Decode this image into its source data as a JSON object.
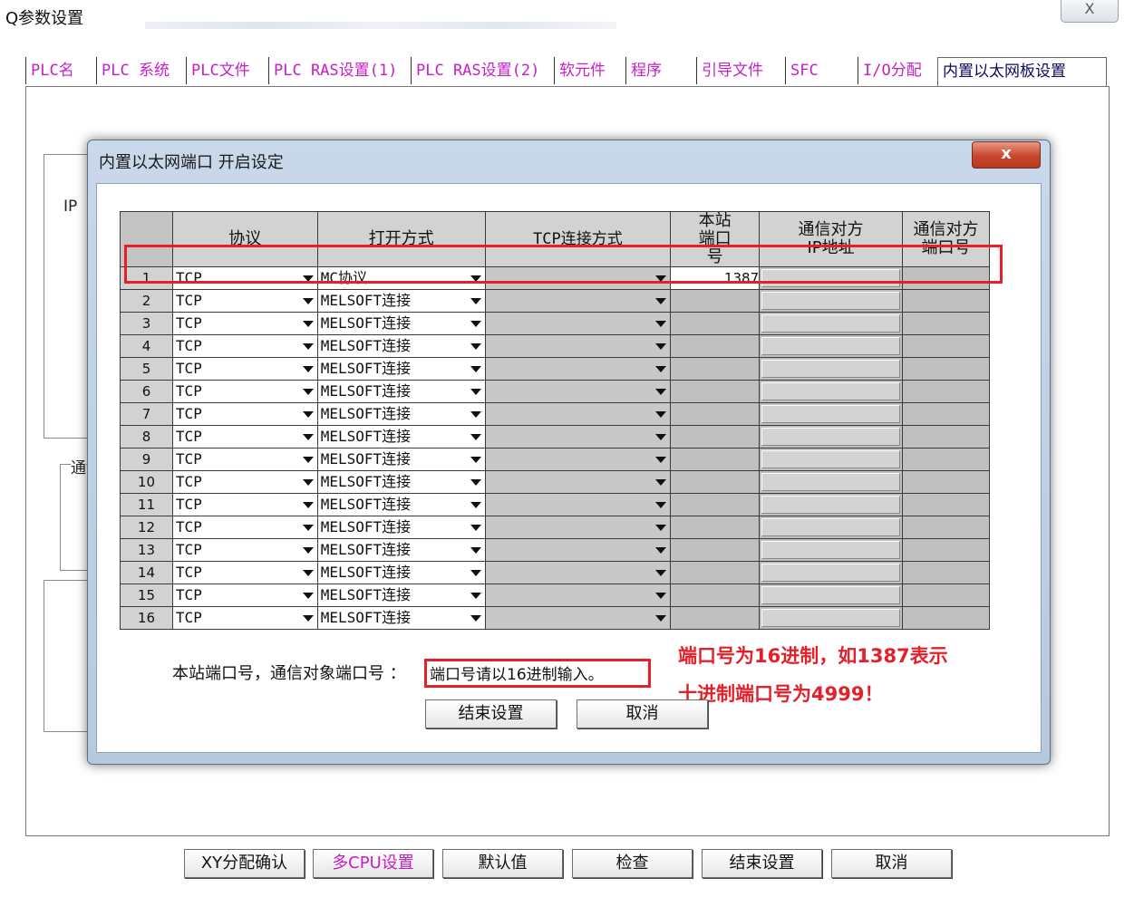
{
  "window": {
    "title": "Q参数设置",
    "close_glyph": "X"
  },
  "tabs": [
    {
      "label": "PLC名"
    },
    {
      "label": "PLC 系统"
    },
    {
      "label": "PLC文件"
    },
    {
      "label": "PLC RAS设置(1)"
    },
    {
      "label": "PLC RAS设置(2)"
    },
    {
      "label": "软元件"
    },
    {
      "label": "程序"
    },
    {
      "label": "引导文件"
    },
    {
      "label": "SFC"
    },
    {
      "label": "I/O分配"
    },
    {
      "label": "内置以太网板设置",
      "active": true
    }
  ],
  "background_fragments": {
    "group1": "IP",
    "group2": "通"
  },
  "dialog": {
    "title": "内置以太网端口 开启设定",
    "close_glyph": "x",
    "columns": {
      "protocol": "协议",
      "open_method": "打开方式",
      "tcp_mode": "TCP连接方式",
      "local_port": "本站端口号",
      "peer_ip": "通信对方IP地址",
      "peer_port": "通信对方端口号"
    },
    "rows": [
      {
        "no": "1",
        "protocol": "TCP",
        "open_method": "MC协议",
        "local_port": "1387"
      },
      {
        "no": "2",
        "protocol": "TCP",
        "open_method": "MELSOFT连接",
        "local_port": ""
      },
      {
        "no": "3",
        "protocol": "TCP",
        "open_method": "MELSOFT连接",
        "local_port": ""
      },
      {
        "no": "4",
        "protocol": "TCP",
        "open_method": "MELSOFT连接",
        "local_port": ""
      },
      {
        "no": "5",
        "protocol": "TCP",
        "open_method": "MELSOFT连接",
        "local_port": ""
      },
      {
        "no": "6",
        "protocol": "TCP",
        "open_method": "MELSOFT连接",
        "local_port": ""
      },
      {
        "no": "7",
        "protocol": "TCP",
        "open_method": "MELSOFT连接",
        "local_port": ""
      },
      {
        "no": "8",
        "protocol": "TCP",
        "open_method": "MELSOFT连接",
        "local_port": ""
      },
      {
        "no": "9",
        "protocol": "TCP",
        "open_method": "MELSOFT连接",
        "local_port": ""
      },
      {
        "no": "10",
        "protocol": "TCP",
        "open_method": "MELSOFT连接",
        "local_port": ""
      },
      {
        "no": "11",
        "protocol": "TCP",
        "open_method": "MELSOFT连接",
        "local_port": ""
      },
      {
        "no": "12",
        "protocol": "TCP",
        "open_method": "MELSOFT连接",
        "local_port": ""
      },
      {
        "no": "13",
        "protocol": "TCP",
        "open_method": "MELSOFT连接",
        "local_port": ""
      },
      {
        "no": "14",
        "protocol": "TCP",
        "open_method": "MELSOFT连接",
        "local_port": ""
      },
      {
        "no": "15",
        "protocol": "TCP",
        "open_method": "MELSOFT连接",
        "local_port": ""
      },
      {
        "no": "16",
        "protocol": "TCP",
        "open_method": "MELSOFT连接",
        "local_port": ""
      }
    ],
    "note_label": "本站端口号，通信对象端口号 ：",
    "note_value": "端口号请以16进制输入。",
    "annotation_line1": "端口号为16进制，如1387表示",
    "annotation_line2": "十进制端口号为4999！",
    "finish_button": "结束设置",
    "cancel_button": "取消"
  },
  "bottom_buttons": [
    {
      "label": "XY分配确认"
    },
    {
      "label": "多CPU设置",
      "accent": true
    },
    {
      "label": "默认值"
    },
    {
      "label": "检查"
    },
    {
      "label": "结束设置"
    },
    {
      "label": "取消"
    }
  ],
  "colors": {
    "accent_magenta": "#c81ec8",
    "highlight_red": "#e5202a",
    "grid_gray": "#c0c0c0"
  }
}
